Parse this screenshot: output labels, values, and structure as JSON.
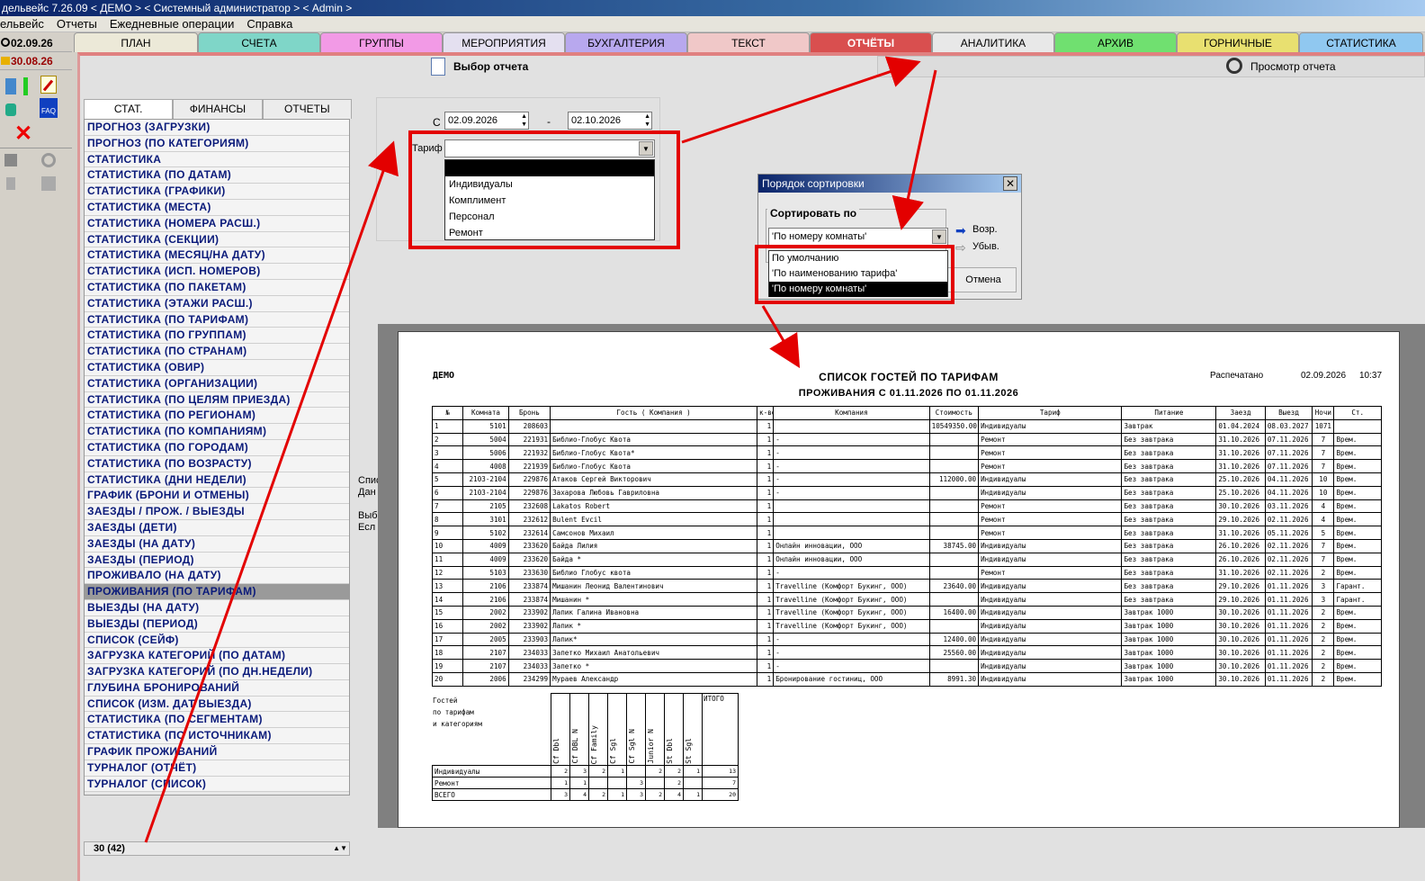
{
  "title": "дельвейс 7.26.09 < ДЕМО > < Системный администратор > < Admin >",
  "menu": [
    "ельвейс",
    "Отчеты",
    "Ежедневные операции",
    "Справка"
  ],
  "left": {
    "date1": "02.09.26",
    "date2": "30.08.26"
  },
  "tabs": [
    {
      "label": "ПЛАН",
      "color": "#ece9d8"
    },
    {
      "label": "СЧЕТА",
      "color": "#7fd6c8"
    },
    {
      "label": "ГРУППЫ",
      "color": "#f29ae6"
    },
    {
      "label": "МЕРОПРИЯТИЯ",
      "color": "#e4e0f0"
    },
    {
      "label": "БУХГАЛТЕРИЯ",
      "color": "#b8a8ee"
    },
    {
      "label": "ТЕКСТ",
      "color": "#f0c8c8"
    },
    {
      "label": "ОТЧЁТЫ",
      "color": "#e07070"
    },
    {
      "label": "АНАЛИТИКА",
      "color": "#e8e8e8"
    },
    {
      "label": "АРХИВ",
      "color": "#70e070"
    },
    {
      "label": "ГОРНИЧНЫЕ",
      "color": "#e8e070"
    },
    {
      "label": "СТАТИСТИКА",
      "color": "#90c8f0"
    }
  ],
  "toolbar": {
    "select_report": "Выбор отчета",
    "preview": "Просмотр отчета"
  },
  "subtabs": [
    "СТАТ.",
    "ФИНАНСЫ",
    "ОТЧЕТЫ"
  ],
  "reports": [
    "ПРОГНОЗ (ЗАГРУЗКИ)",
    "ПРОГНОЗ (ПО КАТЕГОРИЯМ)",
    "СТАТИСТИКА",
    "СТАТИСТИКА (ПО ДАТАМ)",
    "СТАТИСТИКА (ГРАФИКИ)",
    "СТАТИСТИКА (МЕСТА)",
    "СТАТИСТИКА (НОМЕРА РАСШ.)",
    "СТАТИСТИКА (СЕКЦИИ)",
    "СТАТИСТИКА (МЕСЯЦ/НА ДАТУ)",
    "СТАТИСТИКА (ИСП. НОМЕРОВ)",
    "СТАТИСТИКА (ПО ПАКЕТАМ)",
    "СТАТИСТИКА (ЭТАЖИ РАСШ.)",
    "СТАТИСТИКА (ПО ТАРИФАМ)",
    "СТАТИСТИКА (ПО ГРУППАМ)",
    "СТАТИСТИКА (ПО СТРАНАМ)",
    "СТАТИСТИКА (ОВИР)",
    "СТАТИСТИКА (ОРГАНИЗАЦИИ)",
    "СТАТИСТИКА (ПО ЦЕЛЯМ ПРИЕЗДА)",
    "СТАТИСТИКА (ПО РЕГИОНАМ)",
    "СТАТИСТИКА (ПО КОМПАНИЯМ)",
    "СТАТИСТИКА (ПО ГОРОДАМ)",
    "СТАТИСТИКА (ПО ВОЗРАСТУ)",
    "СТАТИСТИКА (ДНИ НЕДЕЛИ)",
    "ГРАФИК (БРОНИ И ОТМЕНЫ)",
    "ЗАЕЗДЫ / ПРОЖ. / ВЫЕЗДЫ",
    "ЗАЕЗДЫ (ДЕТИ)",
    "ЗАЕЗДЫ (НА ДАТУ)",
    "ЗАЕЗДЫ (ПЕРИОД)",
    "ПРОЖИВАЛО (НА ДАТУ)",
    "ПРОЖИВАНИЯ (ПО ТАРИФАМ)",
    "ВЫЕЗДЫ (НА ДАТУ)",
    "ВЫЕЗДЫ (ПЕРИОД)",
    "СПИСОК (СЕЙФ)",
    "ЗАГРУЗКА КАТЕГОРИЙ (ПО ДАТАМ)",
    "ЗАГРУЗКА КАТЕГОРИЙ (ПО ДН.НЕДЕЛИ)",
    "ГЛУБИНА БРОНИРОВАНИЙ",
    "СПИСОК (ИЗМ. ДАТ ВЫЕЗДА)",
    "СТАТИСТИКА (ПО СЕГМЕНТАМ)",
    "СТАТИСТИКА (ПО ИСТОЧНИКАМ)",
    "ГРАФИК ПРОЖИВАНИЙ",
    "ТУРНАЛОГ (ОТЧЁТ)",
    "ТУРНАЛОГ (СПИСОК)"
  ],
  "selected_report_index": 29,
  "list_count": "30 (42)",
  "filter": {
    "from_label": "С",
    "from": "02.09.2026",
    "dash": "-",
    "to": "02.10.2026",
    "tarif_label": "Тариф",
    "tarif_options": [
      "",
      "Индивидуалы",
      "Комплимент",
      "Персонал",
      "Ремонт"
    ]
  },
  "side_text": [
    "Спис",
    "Дан",
    "",
    "Выб",
    "Есл"
  ],
  "sort": {
    "title": "Порядок сортировки",
    "group": "Сортировать по",
    "value": "'По номеру комнаты'",
    "asc": "Возр.",
    "desc": "Убыв.",
    "cancel": "Отмена",
    "options": [
      "По умолчанию",
      "'По наименованию тарифа'",
      "'По номеру комнаты'"
    ]
  },
  "report": {
    "company": "ДЕМО",
    "title1": "СПИСОК ГОСТЕЙ ПО ТАРИФАМ",
    "title2": "ПРОЖИВАНИЯ С  01.11.2026 ПО 01.11.2026",
    "printed_label": "Распечатано",
    "printed_date": "02.09.2026",
    "printed_time": "10:37",
    "headers": [
      "№",
      "Комната",
      "Бронь",
      "Гость ( Компания )",
      "к-во",
      "Компания",
      "Стоимость",
      "Тариф",
      "Питание",
      "Заезд",
      "Выезд",
      "Ночи",
      "Ст."
    ],
    "rows": [
      [
        "1",
        "5101",
        "208603",
        "",
        "1",
        "",
        "10549350.00",
        "Индивидуалы",
        "Завтрак",
        "01.04.2024",
        "08.03.2027",
        "1071",
        ""
      ],
      [
        "2",
        "5004",
        "221931",
        "Библио-Глобус Квота",
        "1",
        "-",
        "",
        "Ремонт",
        "Без завтрака",
        "31.10.2026",
        "07.11.2026",
        "7",
        "Врем."
      ],
      [
        "3",
        "5006",
        "221932",
        "Библио-Глобус Квота*",
        "1",
        "-",
        "",
        "Ремонт",
        "Без завтрака",
        "31.10.2026",
        "07.11.2026",
        "7",
        "Врем."
      ],
      [
        "4",
        "4008",
        "221939",
        "Библио-Глобус Квота",
        "1",
        "-",
        "",
        "Ремонт",
        "Без завтрака",
        "31.10.2026",
        "07.11.2026",
        "7",
        "Врем."
      ],
      [
        "5",
        "2103-2104",
        "229876",
        "Атаков Сергей Викторович",
        "1",
        "-",
        "112000.00",
        "Индивидуалы",
        "Без завтрака",
        "25.10.2026",
        "04.11.2026",
        "10",
        "Врем."
      ],
      [
        "6",
        "2103-2104",
        "229876",
        "Захарова Любовь Гавриловна",
        "1",
        "-",
        "",
        "Индивидуалы",
        "Без завтрака",
        "25.10.2026",
        "04.11.2026",
        "10",
        "Врем."
      ],
      [
        "7",
        "2105",
        "232608",
        "Lakatos Robert",
        "1",
        "",
        "",
        "Ремонт",
        "Без завтрака",
        "30.10.2026",
        "03.11.2026",
        "4",
        "Врем."
      ],
      [
        "8",
        "3101",
        "232612",
        "Bulent Evcil",
        "1",
        "",
        "",
        "Ремонт",
        "Без завтрака",
        "29.10.2026",
        "02.11.2026",
        "4",
        "Врем."
      ],
      [
        "9",
        "5102",
        "232614",
        "Самсонов Михаил",
        "1",
        "",
        "",
        "Ремонт",
        "Без завтрака",
        "31.10.2026",
        "05.11.2026",
        "5",
        "Врем."
      ],
      [
        "10",
        "4009",
        "233620",
        "Байда Лилия",
        "1",
        "Онлайн инновации, ООО",
        "38745.00",
        "Индивидуалы",
        "Без завтрака",
        "26.10.2026",
        "02.11.2026",
        "7",
        "Врем."
      ],
      [
        "11",
        "4009",
        "233620",
        "Байда *",
        "1",
        "Онлайн инновации, ООО",
        "",
        "Индивидуалы",
        "Без завтрака",
        "26.10.2026",
        "02.11.2026",
        "7",
        "Врем."
      ],
      [
        "12",
        "5103",
        "233630",
        "Библио Глобус квота",
        "1",
        "-",
        "",
        "Ремонт",
        "Без завтрака",
        "31.10.2026",
        "02.11.2026",
        "2",
        "Врем."
      ],
      [
        "13",
        "2106",
        "233874",
        "Мишанин Леонид Валентинович",
        "1",
        "Travelline (Комфорт Букинг, ООО)",
        "23640.00",
        "Индивидуалы",
        "Без завтрака",
        "29.10.2026",
        "01.11.2026",
        "3",
        "Гарант."
      ],
      [
        "14",
        "2106",
        "233874",
        "Мишанин *",
        "1",
        "Travelline (Комфорт Букинг, ООО)",
        "",
        "Индивидуалы",
        "Без завтрака",
        "29.10.2026",
        "01.11.2026",
        "3",
        "Гарант."
      ],
      [
        "15",
        "2002",
        "233902",
        "Лапик Галина Ивановна",
        "1",
        "Travelline (Комфорт Букинг, ООО)",
        "16400.00",
        "Индивидуалы",
        "Завтрак 1000",
        "30.10.2026",
        "01.11.2026",
        "2",
        "Врем."
      ],
      [
        "16",
        "2002",
        "233902",
        "Лапик *",
        "1",
        "Travelline (Комфорт Букинг, ООО)",
        "",
        "Индивидуалы",
        "Завтрак 1000",
        "30.10.2026",
        "01.11.2026",
        "2",
        "Врем."
      ],
      [
        "17",
        "2005",
        "233903",
        "Лапик*",
        "1",
        "-",
        "12400.00",
        "Индивидуалы",
        "Завтрак 1000",
        "30.10.2026",
        "01.11.2026",
        "2",
        "Врем."
      ],
      [
        "18",
        "2107",
        "234033",
        "Запетко Михаил  Анатольевич",
        "1",
        "-",
        "25560.00",
        "Индивидуалы",
        "Завтрак 1000",
        "30.10.2026",
        "01.11.2026",
        "2",
        "Врем."
      ],
      [
        "19",
        "2107",
        "234033",
        "Запетко *",
        "1",
        "-",
        "",
        "Индивидуалы",
        "Завтрак 1000",
        "30.10.2026",
        "01.11.2026",
        "2",
        "Врем."
      ],
      [
        "20",
        "2006",
        "234299",
        "Мураев Александр",
        "1",
        "Бронирование гостиниц, ООО",
        "8991.30",
        "Индивидуалы",
        "Завтрак 1000",
        "30.10.2026",
        "01.11.2026",
        "2",
        "Врем."
      ]
    ],
    "summary_caption": [
      "Гостей",
      "по тарифам",
      "и категориям"
    ],
    "summary_cols": [
      "Cf Dbl",
      "Cf DBL N",
      "Cf Family",
      "Cf Sgl",
      "Cf Sgl N",
      "Junior N",
      "St Dbl",
      "St Sgl",
      "ИТОГО"
    ],
    "summary_rows": [
      {
        "name": "Индивидуалы",
        "vals": [
          "2",
          "3",
          "2",
          "1",
          "",
          "2",
          "2",
          "1",
          "13"
        ]
      },
      {
        "name": "Ремонт",
        "vals": [
          "1",
          "1",
          "",
          "",
          "3",
          "",
          "2",
          "",
          "7"
        ]
      },
      {
        "name": "ВСЕГО",
        "vals": [
          "3",
          "4",
          "2",
          "1",
          "3",
          "2",
          "4",
          "1",
          "20"
        ]
      }
    ]
  }
}
